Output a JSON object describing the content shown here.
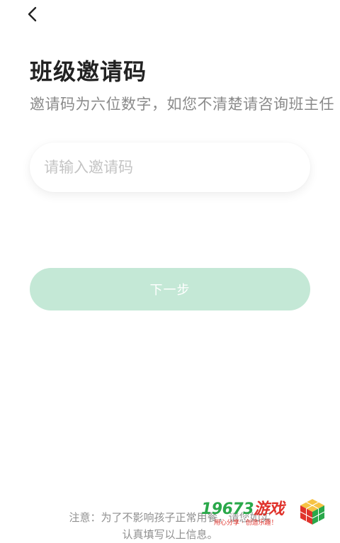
{
  "nav": {
    "back_icon": "chevron-left-icon"
  },
  "page": {
    "title": "班级邀请码",
    "subtitle": "邀请码为六位数字，如您不清楚请咨询班主任"
  },
  "form": {
    "invite_value": "",
    "invite_placeholder": "请输入邀请码",
    "next_label": "下一步"
  },
  "notice": {
    "line1": "注意：为了不影响孩子正常用餐，请您如实",
    "line2": "认真填写以上信息。"
  },
  "watermark": {
    "number": "19673",
    "brand": "游戏",
    "slogan": "用心分享 · 创造乐趣！"
  },
  "colors": {
    "title": "#222222",
    "subtitle": "#8a8a8a",
    "button_disabled": "#c4e8d6",
    "button_text": "#ffffff",
    "placeholder": "#c4c4c4",
    "notice": "#8f8f8f",
    "watermark_green": "#2aa84a",
    "watermark_red": "#e0332c"
  }
}
